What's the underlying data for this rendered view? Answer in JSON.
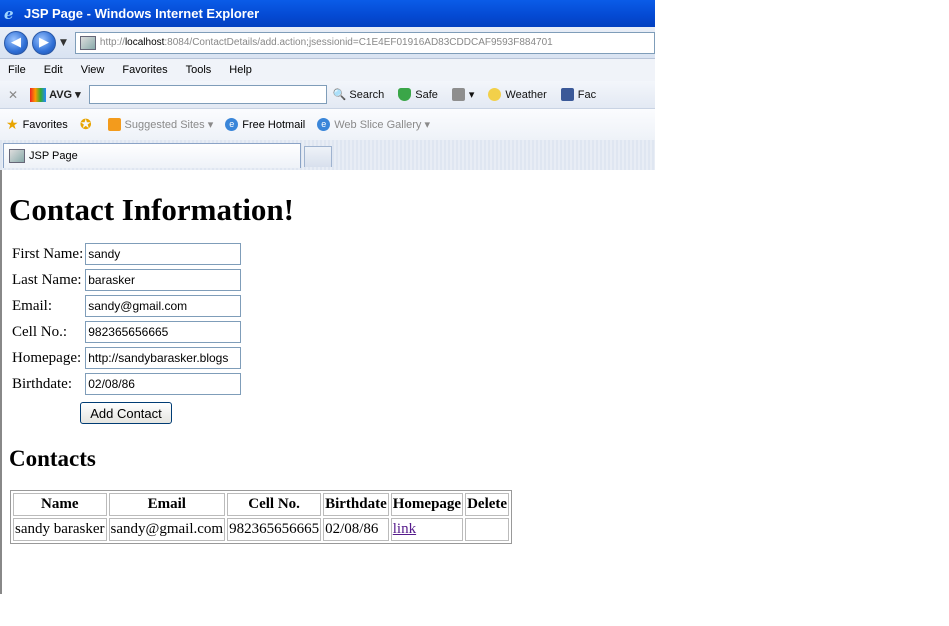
{
  "window": {
    "title": "JSP Page - Windows Internet Explorer",
    "url_prefix": "http://",
    "url_host": "localhost",
    "url_rest": ":8084/ContactDetails/add.action;jsessionid=C1E4EF01916AD83CDDCAF9593F884701"
  },
  "menu": [
    "File",
    "Edit",
    "View",
    "Favorites",
    "Tools",
    "Help"
  ],
  "toolbar": {
    "avg": "AVG",
    "search": "Search",
    "safe": "Safe",
    "weather": "Weather",
    "facebook": "Fac"
  },
  "favorites": {
    "favorites": "Favorites",
    "suggested": "Suggested Sites",
    "hotmail": "Free Hotmail",
    "webslice": "Web Slice Gallery"
  },
  "tab": {
    "title": "JSP Page"
  },
  "page": {
    "heading": "Contact Information!",
    "fields": [
      {
        "label": "First Name:",
        "value": "sandy"
      },
      {
        "label": "Last Name:",
        "value": "barasker"
      },
      {
        "label": "Email:",
        "value": "sandy@gmail.com"
      },
      {
        "label": "Cell No.:",
        "value": "982365656665"
      },
      {
        "label": "Homepage:",
        "value": "http://sandybarasker.blogs"
      },
      {
        "label": "Birthdate:",
        "value": "02/08/86"
      }
    ],
    "submit": "Add Contact",
    "contacts_heading": "Contacts",
    "table": {
      "headers": [
        "Name",
        "Email",
        "Cell No.",
        "Birthdate",
        "Homepage",
        "Delete"
      ],
      "rows": [
        {
          "name": "sandy barasker",
          "email": "sandy@gmail.com",
          "cell": "982365656665",
          "birthdate": "02/08/86",
          "homepage": "link",
          "delete": ""
        }
      ]
    }
  }
}
